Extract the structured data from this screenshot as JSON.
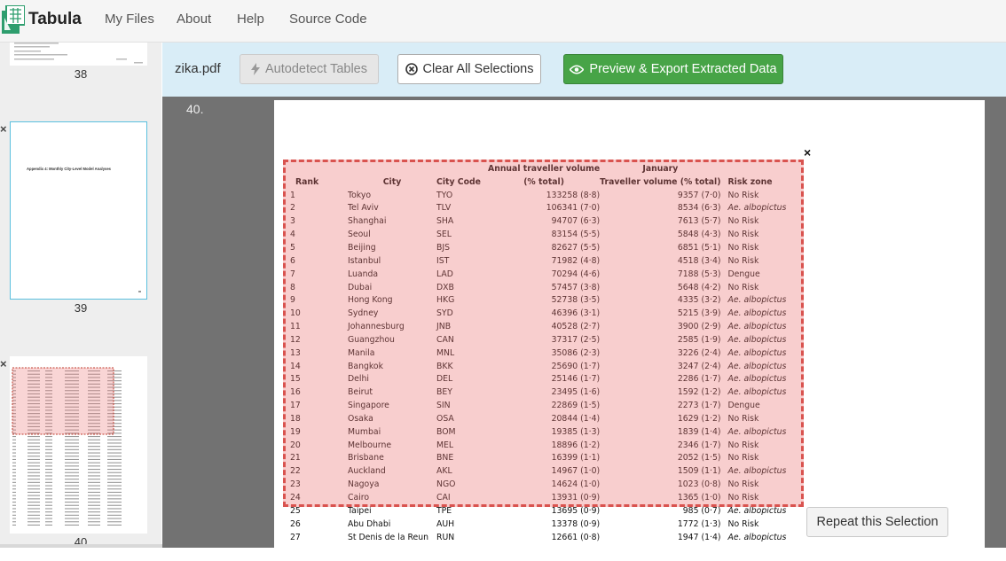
{
  "navbar": {
    "brand": "Tabula",
    "links": [
      "My Files",
      "About",
      "Help",
      "Source Code"
    ]
  },
  "sidebar": {
    "pages": [
      {
        "label": "38",
        "thumb_title": ""
      },
      {
        "label": "39",
        "thumb_title": "Appendix 4: Monthly City-Level Model Analyses"
      },
      {
        "label": "40",
        "thumb_title": ""
      }
    ],
    "close_icon": "×"
  },
  "toolbar": {
    "filename": "zika.pdf",
    "autodetect_label": "Autodetect Tables",
    "clear_label": "Clear All Selections",
    "preview_label": "Preview & Export Extracted Data"
  },
  "viewer": {
    "page_number": "40.",
    "selection_close": "×",
    "repeat_label": "Repeat this Selection"
  },
  "table": {
    "header_top": [
      "",
      "",
      "",
      "Annual traveller volume",
      "January",
      ""
    ],
    "header": [
      "Rank",
      "City",
      "City Code",
      "(% total)",
      "Traveller volume (% total)",
      "Risk zone"
    ],
    "rows": [
      [
        "1",
        "Tokyo",
        "TYO",
        "133258 (8·8)",
        "9357 (7·0)",
        "No Risk"
      ],
      [
        "2",
        "Tel Aviv",
        "TLV",
        "106341 (7·0)",
        "8534 (6·3)",
        "Ae. albopictus"
      ],
      [
        "3",
        "Shanghai",
        "SHA",
        "94707 (6·3)",
        "7613 (5·7)",
        "No Risk"
      ],
      [
        "4",
        "Seoul",
        "SEL",
        "83154 (5·5)",
        "5848 (4·3)",
        "No Risk"
      ],
      [
        "5",
        "Beijing",
        "BJS",
        "82627 (5·5)",
        "6851 (5·1)",
        "No Risk"
      ],
      [
        "6",
        "Istanbul",
        "IST",
        "71982 (4·8)",
        "4518 (3·4)",
        "No Risk"
      ],
      [
        "7",
        "Luanda",
        "LAD",
        "70294 (4·6)",
        "7188 (5·3)",
        "Dengue"
      ],
      [
        "8",
        "Dubai",
        "DXB",
        "57457 (3·8)",
        "5648 (4·2)",
        "No Risk"
      ],
      [
        "9",
        "Hong Kong",
        "HKG",
        "52738 (3·5)",
        "4335 (3·2)",
        "Ae. albopictus"
      ],
      [
        "10",
        "Sydney",
        "SYD",
        "46396 (3·1)",
        "5215 (3·9)",
        "Ae. albopictus"
      ],
      [
        "11",
        "Johannesburg",
        "JNB",
        "40528 (2·7)",
        "3900 (2·9)",
        "Ae. albopictus"
      ],
      [
        "12",
        "Guangzhou",
        "CAN",
        "37317 (2·5)",
        "2585 (1·9)",
        "Ae. albopictus"
      ],
      [
        "13",
        "Manila",
        "MNL",
        "35086 (2·3)",
        "3226 (2·4)",
        "Ae. albopictus"
      ],
      [
        "14",
        "Bangkok",
        "BKK",
        "25690 (1·7)",
        "3247 (2·4)",
        "Ae. albopictus"
      ],
      [
        "15",
        "Delhi",
        "DEL",
        "25146 (1·7)",
        "2286 (1·7)",
        "Ae. albopictus"
      ],
      [
        "16",
        "Beirut",
        "BEY",
        "23495 (1·6)",
        "1592 (1·2)",
        "Ae. albopictus"
      ],
      [
        "17",
        "Singapore",
        "SIN",
        "22869 (1·5)",
        "2273 (1·7)",
        "Dengue"
      ],
      [
        "18",
        "Osaka",
        "OSA",
        "20844 (1·4)",
        "1629 (1·2)",
        "No Risk"
      ],
      [
        "19",
        "Mumbai",
        "BOM",
        "19385 (1·3)",
        "1839 (1·4)",
        "Ae. albopictus"
      ],
      [
        "20",
        "Melbourne",
        "MEL",
        "18896 (1·2)",
        "2346 (1·7)",
        "No Risk"
      ],
      [
        "21",
        "Brisbane",
        "BNE",
        "16399 (1·1)",
        "2052 (1·5)",
        "No Risk"
      ],
      [
        "22",
        "Auckland",
        "AKL",
        "14967 (1·0)",
        "1509 (1·1)",
        "Ae. albopictus"
      ],
      [
        "23",
        "Nagoya",
        "NGO",
        "14624 (1·0)",
        "1023 (0·8)",
        "No Risk"
      ],
      [
        "24",
        "Cairo",
        "CAI",
        "13931 (0·9)",
        "1365 (1·0)",
        "No Risk"
      ],
      [
        "25",
        "Taipei",
        "TPE",
        "13695 (0·9)",
        "985 (0·7)",
        "Ae. albopictus"
      ],
      [
        "26",
        "Abu Dhabi",
        "AUH",
        "13378 (0·9)",
        "1772 (1·3)",
        "No Risk"
      ],
      [
        "27",
        "St Denis de la Reun",
        "RUN",
        "12661 (0·8)",
        "1947 (1·4)",
        "Ae. albopictus"
      ]
    ]
  },
  "colors": {
    "success": "#47a447",
    "toolbar_bg": "#d9edf7",
    "selection_border": "#d9534f",
    "viewer_bg": "#727272"
  }
}
